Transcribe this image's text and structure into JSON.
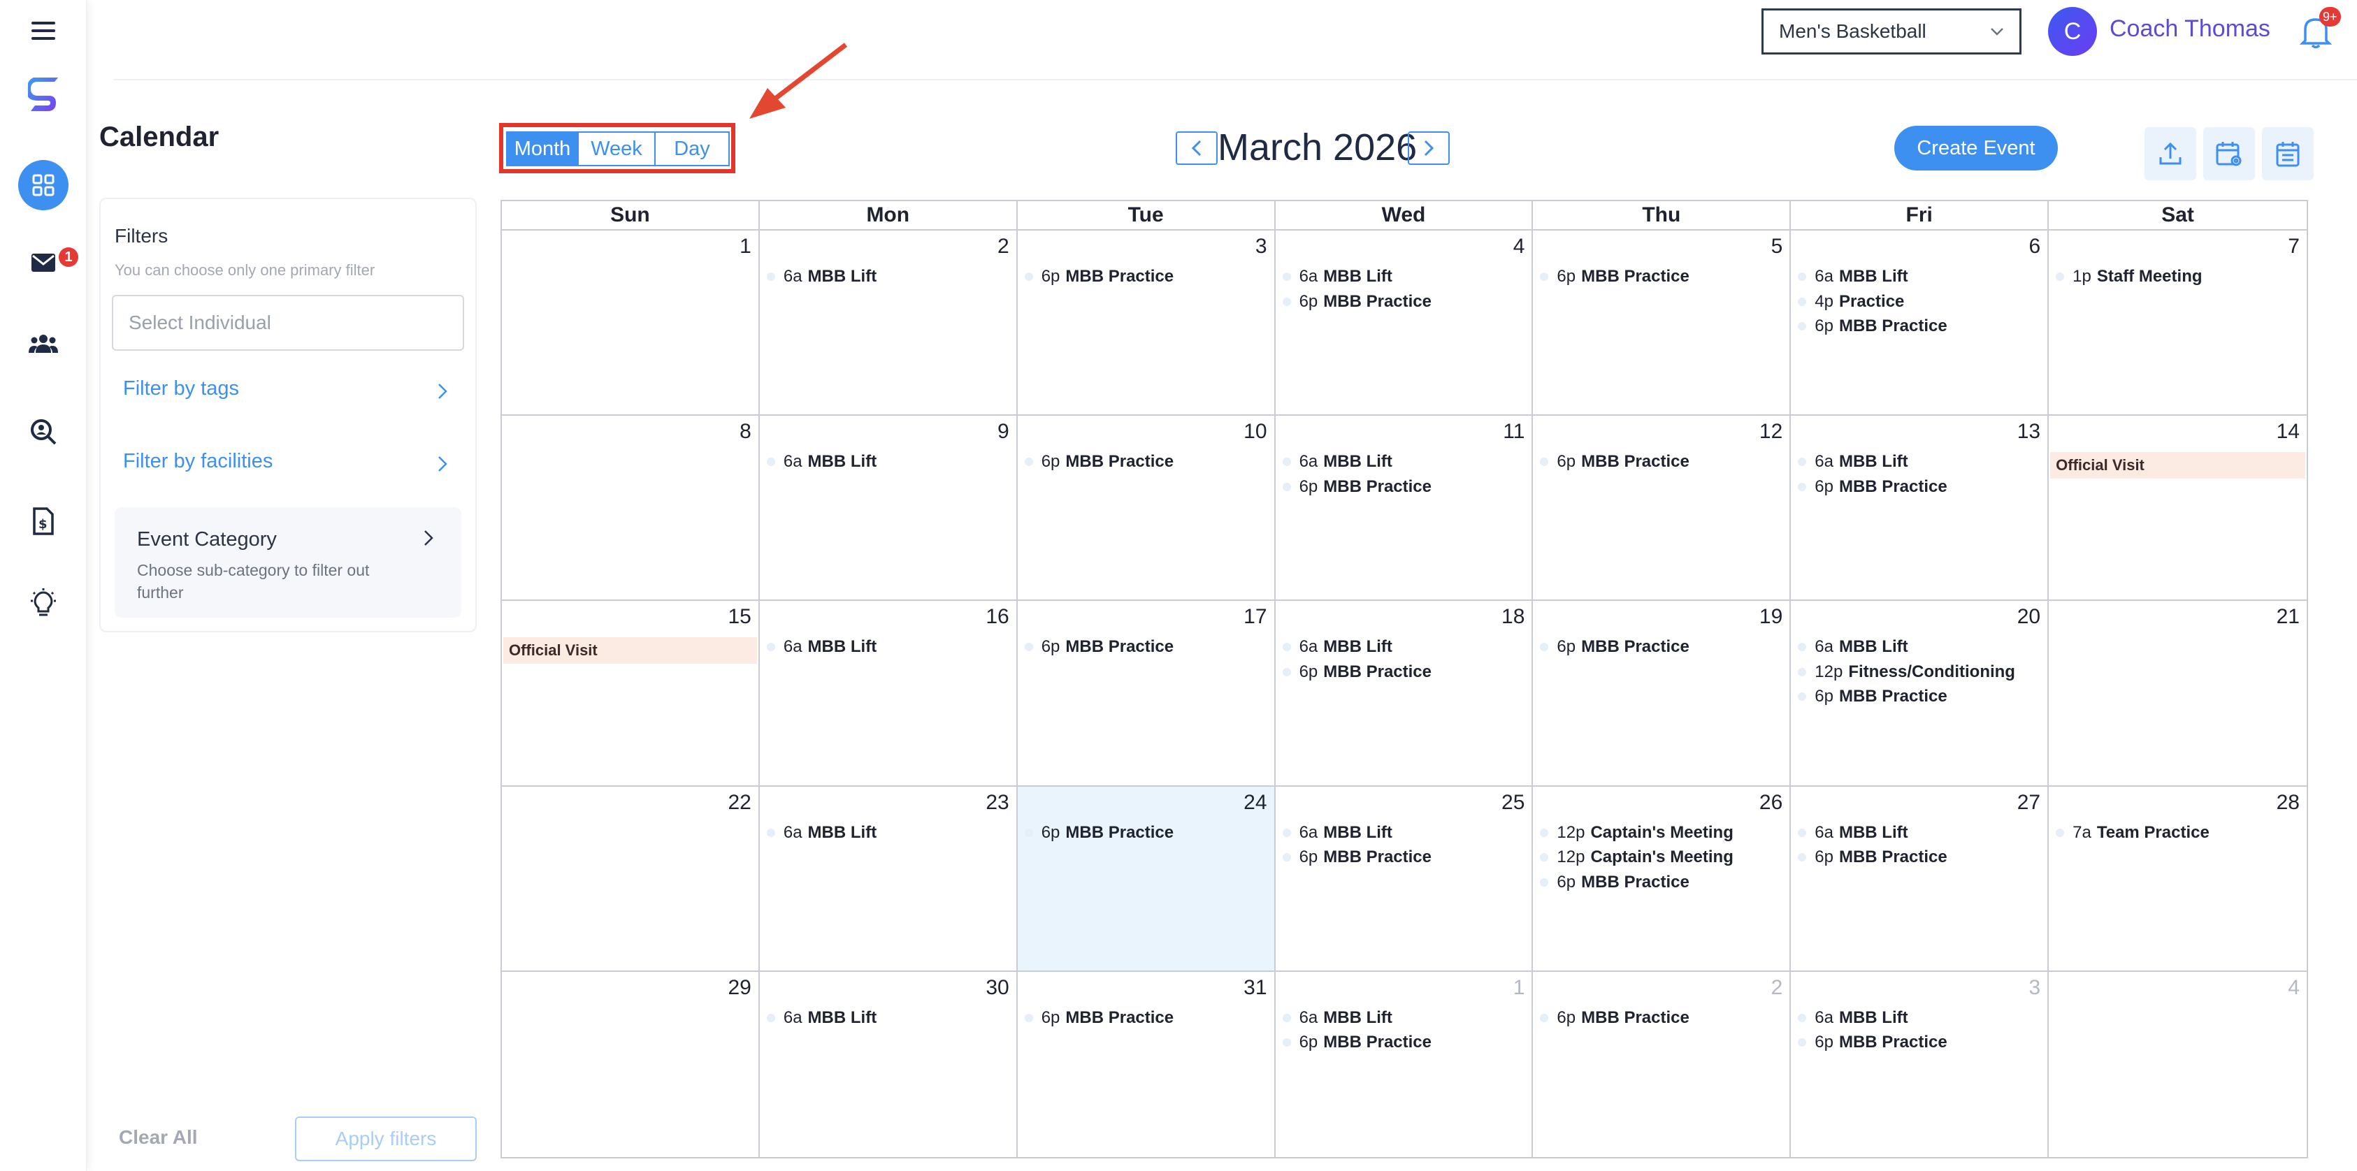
{
  "rail": {
    "items": [
      {
        "icon": "menu-icon"
      },
      {
        "icon": "logo-icon"
      },
      {
        "icon": "dashboard-icon"
      },
      {
        "icon": "mail-icon",
        "badge": "1"
      },
      {
        "icon": "team-icon"
      },
      {
        "icon": "search-person-icon"
      },
      {
        "icon": "document-icon"
      },
      {
        "icon": "lightbulb-icon"
      }
    ]
  },
  "header": {
    "team_select": "Men's Basketball",
    "avatar_letter": "C",
    "user_name": "Coach Thomas",
    "notifications_badge": "9+"
  },
  "sidebar": {
    "title": "Calendar",
    "filters_label": "Filters",
    "filters_sub": "You can choose only one primary filter",
    "select_individual_placeholder": "Select Individual",
    "filter_by_tags": "Filter by tags",
    "filter_by_facilities": "Filter by facilities",
    "event_category_title": "Event Category",
    "event_category_desc": "Choose sub-category to filter out further",
    "clear_all": "Clear All",
    "apply_filters": "Apply filters"
  },
  "toolbar": {
    "views": [
      "Month",
      "Week",
      "Day"
    ],
    "active_view": "Month",
    "month_title": "March 2026",
    "create_event": "Create Event",
    "accent": "#3d8ff0"
  },
  "calendar": {
    "days_of_week": [
      "Sun",
      "Mon",
      "Tue",
      "Wed",
      "Thu",
      "Fri",
      "Sat"
    ],
    "weeks": [
      [
        {
          "day": "1",
          "events": []
        },
        {
          "day": "2",
          "events": [
            {
              "time": "6a",
              "name": "MBB Lift"
            }
          ]
        },
        {
          "day": "3",
          "events": [
            {
              "time": "6p",
              "name": "MBB Practice"
            }
          ]
        },
        {
          "day": "4",
          "events": [
            {
              "time": "6a",
              "name": "MBB Lift"
            },
            {
              "time": "6p",
              "name": "MBB Practice"
            }
          ]
        },
        {
          "day": "5",
          "events": [
            {
              "time": "6p",
              "name": "MBB Practice"
            }
          ]
        },
        {
          "day": "6",
          "events": [
            {
              "time": "6a",
              "name": "MBB Lift"
            },
            {
              "time": "4p",
              "name": "Practice"
            },
            {
              "time": "6p",
              "name": "MBB Practice"
            }
          ]
        },
        {
          "day": "7",
          "events": [
            {
              "time": "1p",
              "name": "Staff Meeting"
            }
          ]
        }
      ],
      [
        {
          "day": "8",
          "events": []
        },
        {
          "day": "9",
          "events": [
            {
              "time": "6a",
              "name": "MBB Lift"
            }
          ]
        },
        {
          "day": "10",
          "events": [
            {
              "time": "6p",
              "name": "MBB Practice"
            }
          ]
        },
        {
          "day": "11",
          "events": [
            {
              "time": "6a",
              "name": "MBB Lift"
            },
            {
              "time": "6p",
              "name": "MBB Practice"
            }
          ]
        },
        {
          "day": "12",
          "events": [
            {
              "time": "6p",
              "name": "MBB Practice"
            }
          ]
        },
        {
          "day": "13",
          "events": [
            {
              "time": "6a",
              "name": "MBB Lift"
            },
            {
              "time": "6p",
              "name": "MBB Practice"
            }
          ]
        },
        {
          "day": "14",
          "banner": "Official Visit",
          "events": []
        }
      ],
      [
        {
          "day": "15",
          "banner": "Official Visit",
          "events": []
        },
        {
          "day": "16",
          "events": [
            {
              "time": "6a",
              "name": "MBB Lift"
            }
          ]
        },
        {
          "day": "17",
          "events": [
            {
              "time": "6p",
              "name": "MBB Practice"
            }
          ]
        },
        {
          "day": "18",
          "events": [
            {
              "time": "6a",
              "name": "MBB Lift"
            },
            {
              "time": "6p",
              "name": "MBB Practice"
            }
          ]
        },
        {
          "day": "19",
          "events": [
            {
              "time": "6p",
              "name": "MBB Practice"
            }
          ]
        },
        {
          "day": "20",
          "events": [
            {
              "time": "6a",
              "name": "MBB Lift"
            },
            {
              "time": "12p",
              "name": "Fitness/Conditioning"
            },
            {
              "time": "6p",
              "name": "MBB Practice"
            }
          ]
        },
        {
          "day": "21",
          "events": []
        }
      ],
      [
        {
          "day": "22",
          "events": []
        },
        {
          "day": "23",
          "events": [
            {
              "time": "6a",
              "name": "MBB Lift"
            }
          ]
        },
        {
          "day": "24",
          "today": true,
          "events": [
            {
              "time": "6p",
              "name": "MBB Practice"
            }
          ]
        },
        {
          "day": "25",
          "events": [
            {
              "time": "6a",
              "name": "MBB Lift"
            },
            {
              "time": "6p",
              "name": "MBB Practice"
            }
          ]
        },
        {
          "day": "26",
          "events": [
            {
              "time": "12p",
              "name": "Captain's Meeting"
            },
            {
              "time": "12p",
              "name": "Captain's Meeting"
            },
            {
              "time": "6p",
              "name": "MBB Practice"
            }
          ]
        },
        {
          "day": "27",
          "events": [
            {
              "time": "6a",
              "name": "MBB Lift"
            },
            {
              "time": "6p",
              "name": "MBB Practice"
            }
          ]
        },
        {
          "day": "28",
          "events": [
            {
              "time": "7a",
              "name": "Team Practice"
            }
          ]
        }
      ],
      [
        {
          "day": "29",
          "events": []
        },
        {
          "day": "30",
          "events": [
            {
              "time": "6a",
              "name": "MBB Lift"
            }
          ]
        },
        {
          "day": "31",
          "events": [
            {
              "time": "6p",
              "name": "MBB Practice"
            }
          ]
        },
        {
          "day": "1",
          "other": true,
          "events": [
            {
              "time": "6a",
              "name": "MBB Lift"
            },
            {
              "time": "6p",
              "name": "MBB Practice"
            }
          ]
        },
        {
          "day": "2",
          "other": true,
          "events": [
            {
              "time": "6p",
              "name": "MBB Practice"
            }
          ]
        },
        {
          "day": "3",
          "other": true,
          "events": [
            {
              "time": "6a",
              "name": "MBB Lift"
            },
            {
              "time": "6p",
              "name": "MBB Practice"
            }
          ]
        },
        {
          "day": "4",
          "other": true,
          "events": []
        }
      ]
    ]
  }
}
